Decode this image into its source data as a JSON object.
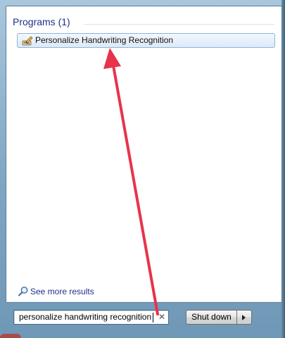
{
  "start_menu": {
    "group_header": "Programs (1)",
    "results": [
      {
        "label": "Personalize Handwriting Recognition",
        "icon": "handwriting-icon"
      }
    ],
    "see_more_label": "See more results"
  },
  "search": {
    "value": "personalize handwriting recognition",
    "clear_glyph": "✕"
  },
  "shutdown": {
    "label": "Shut down"
  },
  "colors": {
    "group_header": "#1e3287",
    "selection_border": "#8fb5d6",
    "annotation_arrow": "#e8334a"
  }
}
